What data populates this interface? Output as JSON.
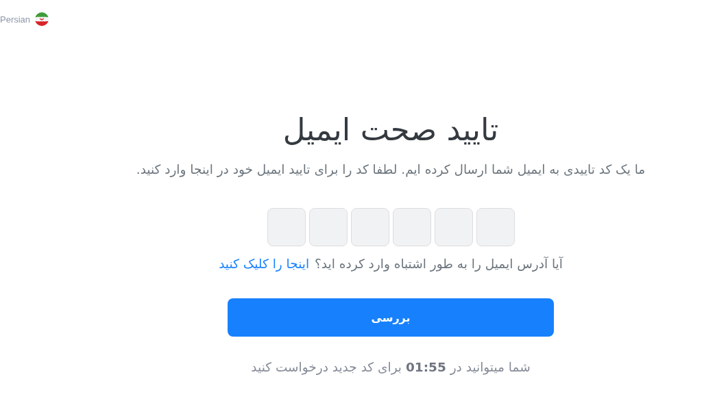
{
  "language_selector": {
    "label": "Persian"
  },
  "title": "تایید صحت ایمیل",
  "subtitle": "ما یک کد تاییدی به ایمیل شما ارسال کرده ایم. لطفا کد را برای تایید ایمیل خود در اینجا وارد کنید.",
  "code_inputs": [
    {
      "kind": "digit"
    },
    {
      "kind": "digit"
    },
    {
      "kind": "digit"
    },
    {
      "kind": "digit"
    },
    {
      "kind": "digit"
    },
    {
      "kind": "digit"
    }
  ],
  "email_hint": {
    "question": "آیا آدرس ایمیل را به طور اشتباه وارد کرده اید؟",
    "link": "اینجا را کلیک کنید"
  },
  "submit_button": {
    "label": "بررسی"
  },
  "resend_timer": "شما میتوانید در **01:55** برای کد جدید درخواست کنید"
}
